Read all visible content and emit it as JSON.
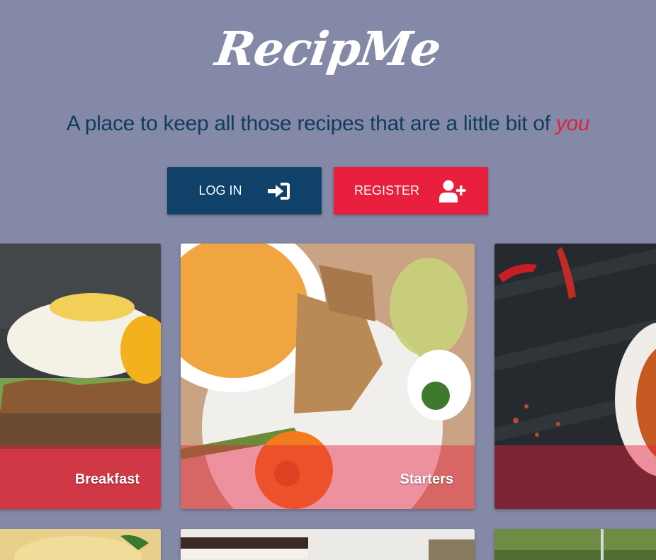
{
  "header": {
    "logo": "RecipMe",
    "tagline": "A place to keep all those recipes that are a little bit of",
    "tagline_highlight": "you"
  },
  "actions": {
    "login_label": "LOG IN",
    "register_label": "REGISTER"
  },
  "categories": [
    {
      "label": "Breakfast"
    },
    {
      "label": "Starters"
    },
    {
      "label": ""
    }
  ],
  "colors": {
    "background": "#8389a6",
    "primary": "#0f416a",
    "accent": "#e81f3d"
  }
}
